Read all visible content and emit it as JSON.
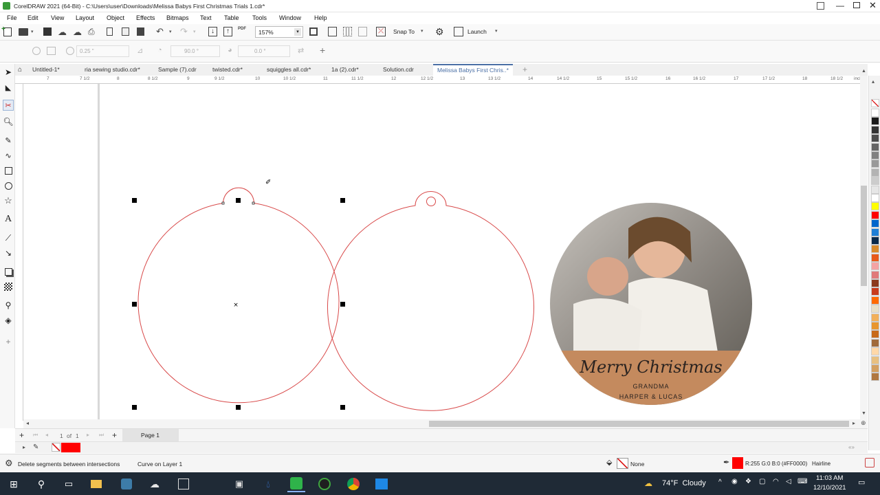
{
  "app": {
    "title": "CorelDRAW 2021 (64-Bit) - C:\\Users\\user\\Downloads\\Melissa Babys First Christmas Trials 1.cdr*"
  },
  "menu": [
    "File",
    "Edit",
    "View",
    "Layout",
    "Object",
    "Effects",
    "Bitmaps",
    "Text",
    "Table",
    "Tools",
    "Window",
    "Help"
  ],
  "standard_toolbar": {
    "zoom": "157%",
    "snap_to": "Snap To",
    "launch": "Launch"
  },
  "property_bar": {
    "outline_width": "0.25 \"",
    "angle_start": "90.0 °",
    "angle_end": "0.0 °"
  },
  "tabs": [
    "Untitled-1*",
    "ria sewing studio.cdr*",
    "Sample (7).cdr",
    "twisted.cdr*",
    "squiggles all.cdr*",
    "1a (2).cdr*",
    "Solution.cdr",
    "Melissa Babys First Chris..*"
  ],
  "active_tab": 7,
  "ruler": {
    "labels": [
      "7",
      "7 1/2",
      "8",
      "8 1/2",
      "9",
      "9 1/2",
      "10",
      "10 1/2",
      "11",
      "11 1/2",
      "12",
      "12 1/2",
      "13",
      "13 1/2",
      "14",
      "14 1/2",
      "15",
      "15 1/2",
      "16",
      "16 1/2",
      "17",
      "17 1/2",
      "18",
      "18 1/2"
    ],
    "unit": "inches"
  },
  "ornament": {
    "line1": "Merry Christmas",
    "line2": "GRANDMA",
    "line3": "HARPER & LUCAS"
  },
  "page_nav": {
    "current": "1",
    "of_label": "of",
    "total": "1",
    "page_tab": "Page 1"
  },
  "status": {
    "hint": "Delete segments between intersections",
    "object": "Curve on Layer 1",
    "fill": "None",
    "outline_color": "R:255 G:0 B:0 (#FF0000)",
    "outline_width": "Hairline"
  },
  "palette_colors": [
    "#ffffff",
    "#1a1a1a",
    "#333333",
    "#4d4d4d",
    "#666666",
    "#808080",
    "#999999",
    "#b3b3b3",
    "#cccccc",
    "#e6e6e6",
    "#ffffff",
    "#ffff00",
    "#ff0000",
    "#0066cc",
    "#1e7fd6",
    "#0a2a4a",
    "#d98b2b",
    "#e85a1a",
    "#f4a3a3",
    "#e07a7a",
    "#8b3a1e",
    "#c83c1c",
    "#ff6a00",
    "#e8e0c8",
    "#f2b05a",
    "#e8962e",
    "#c86a1a",
    "#a06a3a",
    "#ffd8a8",
    "#e8c080",
    "#d4a060",
    "#b07840"
  ],
  "colors": {
    "accent": "#4a6fa5",
    "curve": "#d84848",
    "current_outline": "#ff0000"
  },
  "taskbar": {
    "weather": "74°F  Cloudy",
    "time": "11:03 AM",
    "date": "12/10/2021"
  }
}
